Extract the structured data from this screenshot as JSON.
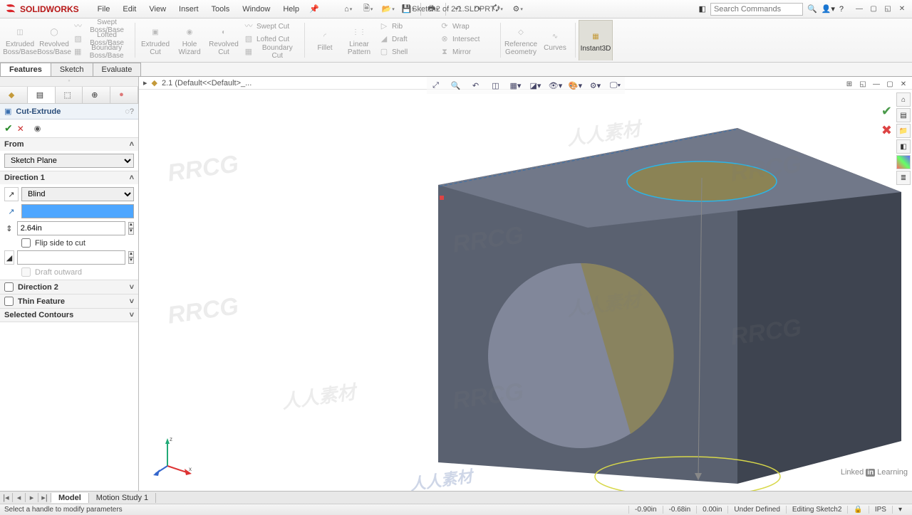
{
  "app": {
    "name": "SOLIDWORKS",
    "doc_title": "Sketch2 of 2.1.SLDPRT *",
    "search_placeholder": "Search Commands"
  },
  "menu": [
    "File",
    "Edit",
    "View",
    "Insert",
    "Tools",
    "Window",
    "Help"
  ],
  "ribbon_tabs": [
    "Features",
    "Sketch",
    "Evaluate"
  ],
  "ribbon": {
    "extruded_boss": "Extruded Boss/Base",
    "revolved_boss": "Revolved Boss/Base",
    "swept_boss": "Swept Boss/Base",
    "lofted_boss": "Lofted Boss/Base",
    "boundary_boss": "Boundary Boss/Base",
    "extruded_cut": "Extruded Cut",
    "hole_wizard": "Hole Wizard",
    "revolved_cut": "Revolved Cut",
    "swept_cut": "Swept Cut",
    "lofted_cut": "Lofted Cut",
    "boundary_cut": "Boundary Cut",
    "fillet": "Fillet",
    "linear_pattern": "Linear Pattern",
    "rib": "Rib",
    "draft": "Draft",
    "shell": "Shell",
    "wrap": "Wrap",
    "intersect": "Intersect",
    "mirror": "Mirror",
    "ref_geom": "Reference Geometry",
    "curves": "Curves",
    "instant3d": "Instant3D"
  },
  "tree_item": "2.1 (Default<<Default>_...",
  "feature": {
    "title": "Cut-Extrude",
    "from_label": "From",
    "from_value": "Sketch Plane",
    "dir1_label": "Direction 1",
    "dir1_type": "Blind",
    "dir1_depth": "",
    "dir1_angle": "2.64in",
    "flip_label": "Flip side to cut",
    "draft_outward": "Draft outward",
    "dir2_label": "Direction 2",
    "thin_label": "Thin Feature",
    "selected_label": "Selected Contours"
  },
  "bottom_tabs": {
    "model": "Model",
    "motion": "Motion Study 1"
  },
  "status": {
    "hint": "Select a handle to modify parameters",
    "x": "-0.90in",
    "y": "-0.68in",
    "z": "0.00in",
    "state": "Under Defined",
    "mode": "Editing Sketch2",
    "units": "IPS"
  },
  "linkedin": "Learning",
  "watermark_a": "RRCG",
  "watermark_b": "人人素材"
}
